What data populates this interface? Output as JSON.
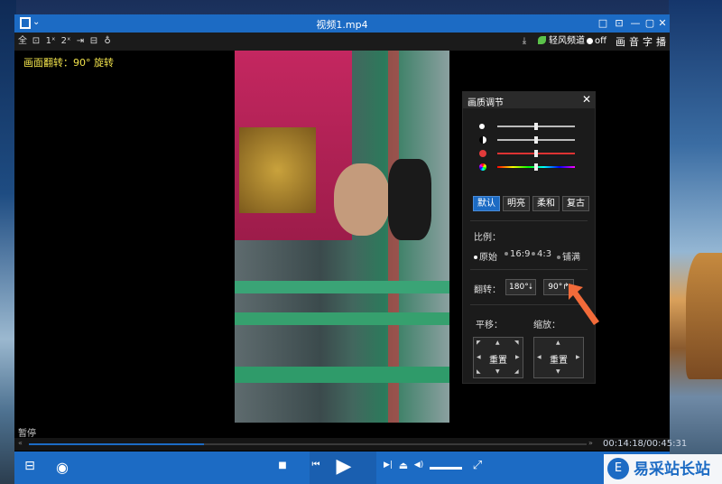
{
  "window": {
    "title": "视频1.mp4",
    "controls": [
      "□",
      "⊡",
      "—",
      "▢",
      "✕"
    ]
  },
  "toolbar": {
    "items": [
      "全",
      "⊡",
      "1ˣ",
      "2ˣ",
      "⇥",
      "⊟",
      "♁"
    ],
    "download_icon": "⤓",
    "channel_label": "轻风频道",
    "channel_state": "off",
    "right_tabs": [
      "画",
      "音",
      "字",
      "播"
    ]
  },
  "osd": {
    "text": "画面翻转：90° 旋转"
  },
  "panel": {
    "title": "画质调节",
    "close": "✕",
    "sliders": [
      {
        "name": "brightness",
        "value": 0.5,
        "color": "#ffffff"
      },
      {
        "name": "contrast",
        "value": 0.5,
        "color": "#ffffff"
      },
      {
        "name": "saturation",
        "value": 0.5,
        "color": "#e23b3b"
      },
      {
        "name": "hue",
        "value": 0.5,
        "color": "rainbow"
      }
    ],
    "presets": [
      "默认",
      "明亮",
      "柔和",
      "复古"
    ],
    "active_preset": "默认",
    "ratio_label": "比例：",
    "ratios": [
      "原始",
      "16:9",
      "4:3",
      "铺满"
    ],
    "selected_ratio": "原始",
    "flip_label": "翻转：",
    "flip_buttons": [
      "180°",
      "90°"
    ],
    "pan_label": "平移：",
    "zoom_label": "缩放：",
    "pan_reset": "重置",
    "zoom_reset": "重置"
  },
  "status": {
    "text": "暂停"
  },
  "seek": {
    "time": "00:14:18/00:45:31",
    "progress": 0.314
  },
  "bottom": {
    "list_icon": "⊟",
    "eye_icon": "◉",
    "stop_icon": "■",
    "prev_icon": "⏮",
    "play_icon": "▶",
    "next_icon": "▶|",
    "eject_icon": "⏏",
    "volume_icon": "◀)",
    "fullscreen_icon": "⤢"
  },
  "watermark": {
    "text": "易采站长站",
    "logo_char": "E"
  },
  "colors": {
    "accent": "#1c6bc4",
    "osd": "#f2e34c",
    "pointer": "#f26b3a"
  }
}
